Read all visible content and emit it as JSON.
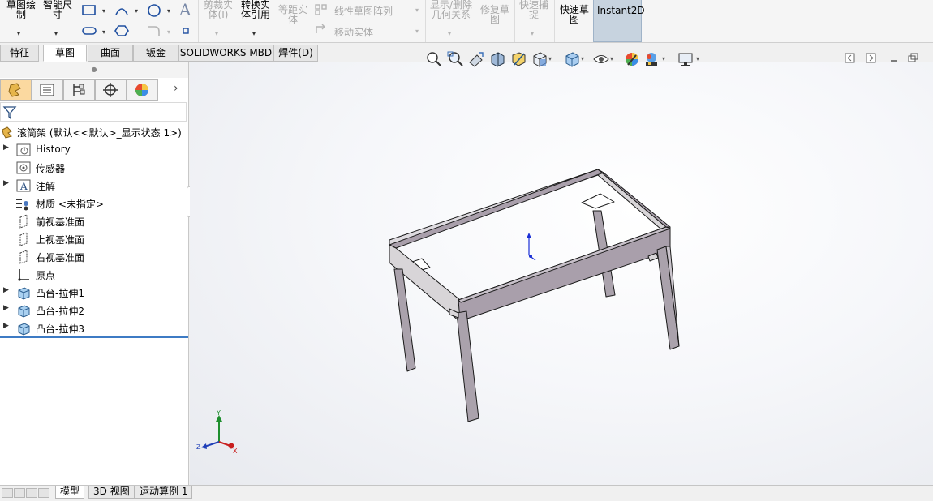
{
  "ribbon": {
    "sketch_draw": "草图绘\n制",
    "smart_dim": "智能尺\n寸",
    "text_tool": "A",
    "trim": "剪裁实\n体(I)",
    "convert": "转换实\n体引用",
    "offset": "等距实\n体",
    "linear_pattern": "线性草图阵列",
    "move_entities": "移动实体",
    "show_delete_relations": "显示/删除\n几何关系",
    "repair_sketch": "修复草\n图",
    "quick_snap": "快速捕\n捉",
    "quick_sketch": "快速草\n图",
    "instant2d": "Instant2D"
  },
  "tabs": [
    "特征",
    "草图",
    "曲面",
    "钣金",
    "SOLIDWORKS MBD",
    "焊件(D)"
  ],
  "active_tab": "草图",
  "tree": {
    "root": "滚筒架  (默认<<默认>_显示状态 1>)",
    "items": [
      "History",
      "传感器",
      "注解",
      "材质 <未指定>",
      "前视基准面",
      "上视基准面",
      "右视基准面",
      "原点",
      "凸台-拉伸1",
      "凸台-拉伸2",
      "凸台-拉伸3"
    ]
  },
  "triad": {
    "x": "X",
    "y": "Y",
    "z": "Z"
  },
  "bottom_tabs": [
    "模型",
    "3D 视图",
    "运动算例 1"
  ],
  "colors": {
    "frame_top": "#a99fab",
    "frame_side": "#d8d5d8",
    "legs": "#aaa2ac",
    "edge": "#1a1a1a",
    "selection_line": "#3d7bc4",
    "instant2d_bg": "#c7d3df"
  },
  "icons": [
    "zoom-to-fit-icon",
    "zoom-area-icon",
    "previous-view-icon",
    "section-view-icon",
    "dynamic-annotation-icon",
    "view-orientation-icon",
    "display-style-icon",
    "hide-show-icon",
    "edit-appearance-icon",
    "apply-scene-icon",
    "view-settings-icon",
    "feature-manager-icon",
    "property-manager-icon",
    "configuration-manager-icon",
    "dim-xpert-icon",
    "display-manager-icon",
    "filter-icon"
  ]
}
